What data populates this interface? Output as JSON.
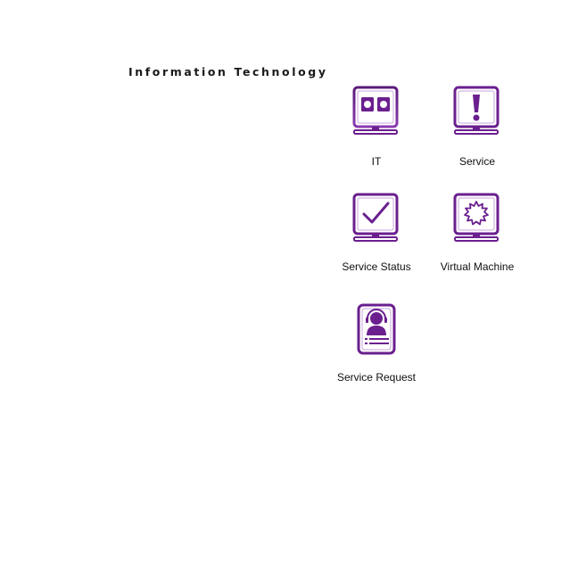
{
  "section": {
    "title": "Information Technology"
  },
  "tiles": [
    {
      "label": "IT",
      "icon": "server-monitor-icon"
    },
    {
      "label": "Service",
      "icon": "alert-monitor-icon"
    },
    {
      "label": "Service Status",
      "icon": "check-monitor-icon"
    },
    {
      "label": "Virtual Machine",
      "icon": "gear-monitor-icon"
    },
    {
      "label": "Service Request",
      "icon": "support-agent-icon"
    }
  ],
  "colors": {
    "accent": "#6b1f8f",
    "accent_light": "#b88ad0"
  }
}
